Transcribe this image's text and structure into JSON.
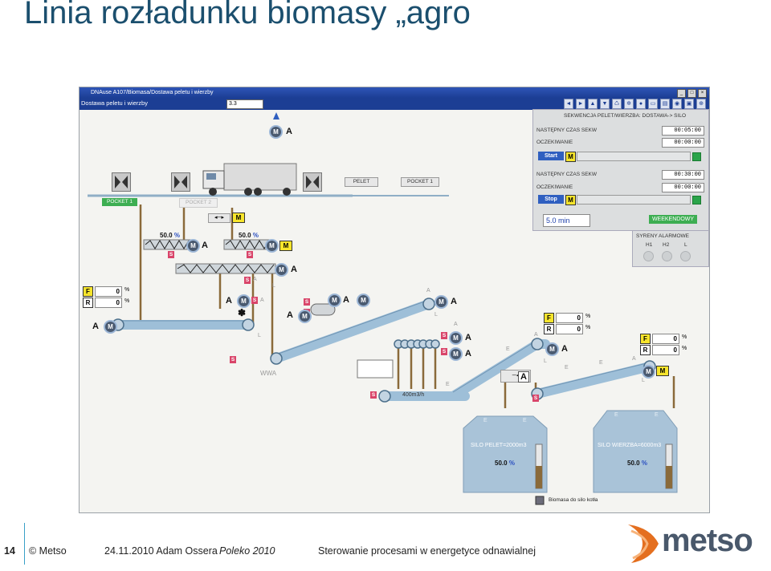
{
  "slide": {
    "title": "Linia rozładunku biomasy „agro",
    "page_number": "14",
    "footer_company": "© Metso",
    "footer_date_author": "24.11.2010 Adam Ossera",
    "footer_event": "Poleko 2010",
    "footer_topic": "Sterowanie procesami w energetyce odnawialnej",
    "logo_text": "metso"
  },
  "window": {
    "title": "DNAuse A107/Biomasa/Dostawa peletu i wierzby",
    "screen_name": "Dostawa peletu i wierzby",
    "input_value": "3.3",
    "toolbar_icons": [
      "arrow-left-icon",
      "arrow-right-icon",
      "arrow-up-icon",
      "arrow-down-icon",
      "recycle-icon",
      "gear-icon",
      "circle-icon",
      "folder-icon",
      "print-icon",
      "camera-icon",
      "save-icon",
      "zoom-icon"
    ]
  },
  "sequence": {
    "header": "SEKWENCJA PELET/WIERZBA: DOSTAWA-> SILO",
    "next_time_label_1": "NASTĘPNY CZAS SEKW",
    "next_time_1": "00:05:00",
    "wait_label_1": "OCZEKIWANIE",
    "wait_1": "00:00:00",
    "start_label": "Start",
    "start_mode": "M",
    "next_time_label_2": "NASTĘPNY CZAS SEKW",
    "next_time_2": "00:30:00",
    "wait_label_2": "OCZEKIWANIE",
    "wait_2": "00:00:00",
    "stop_label": "Stop",
    "stop_mode": "M",
    "interval_value": "5.0",
    "interval_unit": "min",
    "weekend_label": "WEEKENDOWY"
  },
  "sirens": {
    "header": "SYRENY ALARMOWE",
    "labels": [
      "H1",
      "H2",
      "L"
    ]
  },
  "process": {
    "top_motor_m": "M",
    "top_motor_a": "A",
    "pelet_btn": "PELET",
    "pocket1_btn": "POCKET 1",
    "pocket1_tag": "POCKET 1",
    "pocket2_tag": "POCKET 2",
    "truck_m": "M",
    "feeder1_pct": "50.0",
    "feeder2_pct": "50.0",
    "pct_unit": "%",
    "left_fr": {
      "f": "F",
      "f_val": "0",
      "r": "R",
      "r_val": "0",
      "unit": "%"
    },
    "mid_fr": {
      "f": "F",
      "f_val": "0",
      "r": "R",
      "r_val": "0",
      "unit": "%"
    },
    "right_fr": {
      "f": "F",
      "f_val": "0",
      "r": "R",
      "r_val": "0",
      "unit": "%"
    },
    "wwa_label": "WWA",
    "conveyor_label": "400m3/h",
    "letter_a": "A",
    "letter_m": "M",
    "letter_s": "S",
    "letter_l": "L",
    "letter_e": "E"
  },
  "silos": {
    "pelet_label": "SILO PELET=2000m3",
    "pelet_pct": "50.0",
    "wierzba_label": "SILO WIERZBA=6000m3",
    "wierzba_pct": "50.0",
    "unit": "%",
    "legend": "Biomasa do silo kotła"
  },
  "colors": {
    "title": "#1b4f6e",
    "pipe": "#9ebfd8",
    "silo": "#a9c3d8",
    "feed_line": "#8a6a3a",
    "accent_blue": "#2f5fc0",
    "green": "#3dae52"
  }
}
